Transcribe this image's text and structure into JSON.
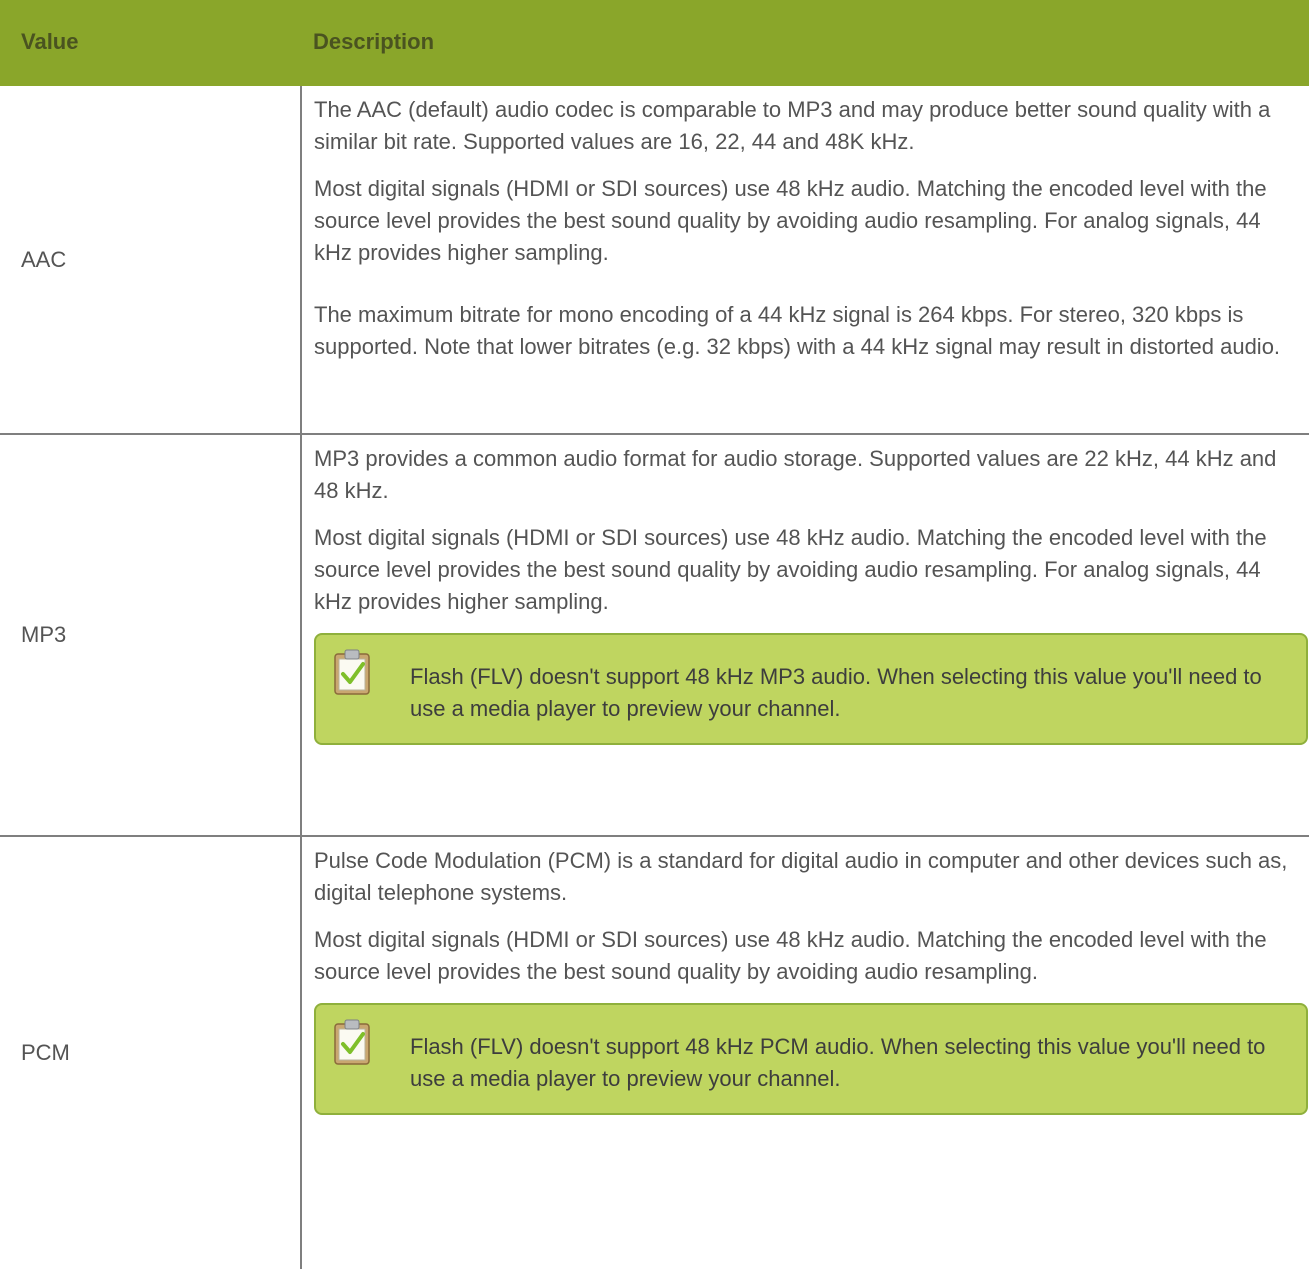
{
  "table": {
    "headers": {
      "value": "Value",
      "description": "Description"
    },
    "rows": [
      {
        "value": "AAC",
        "paragraphs": [
          "The AAC (default) audio codec is comparable to MP3 and may produce better sound quality with a similar bit rate. Supported values are 16, 22, 44 and 48K kHz.",
          "Most digital signals (HDMI or SDI sources) use 48 kHz audio. Matching the encoded level with the source level provides the best sound quality by avoiding audio resampling. For analog signals, 44 kHz provides higher sampling.",
          "The maximum bitrate for mono encoding of a 44 kHz signal is 264 kbps. For stereo, 320 kbps is supported. Note that lower bitrates (e.g. 32 kbps) with a 44 kHz signal may result in distorted audio."
        ]
      },
      {
        "value": "MP3",
        "paragraphs": [
          "MP3 provides a common audio format for audio storage. Supported values are 22 kHz, 44 kHz and 48 kHz.",
          "Most digital signals (HDMI or SDI sources) use 48 kHz audio. Matching the encoded level with the source level provides the best sound quality by avoiding audio resampling. For analog signals, 44 kHz provides higher sampling."
        ],
        "note": "Flash (FLV) doesn't support 48 kHz MP3 audio. When selecting this value you'll need to use a media player to preview your channel."
      },
      {
        "value": "PCM",
        "paragraphs": [
          "Pulse Code Modulation (PCM) is a standard for digital audio in computer and other devices such as, digital telephone systems.",
          "Most digital signals (HDMI or SDI sources) use 48 kHz audio. Matching the encoded level with the source level provides the best sound quality by avoiding audio resampling."
        ],
        "note": "Flash (FLV) doesn't support 48 kHz PCM audio. When selecting this value you'll need to use a media player to preview your channel."
      }
    ]
  },
  "icons": {
    "note": "clipboard-check-icon"
  },
  "colors": {
    "header_bg": "#8aa62a",
    "header_text": "#4a5320",
    "note_bg": "#bfd560",
    "note_border": "#8fb03c"
  }
}
